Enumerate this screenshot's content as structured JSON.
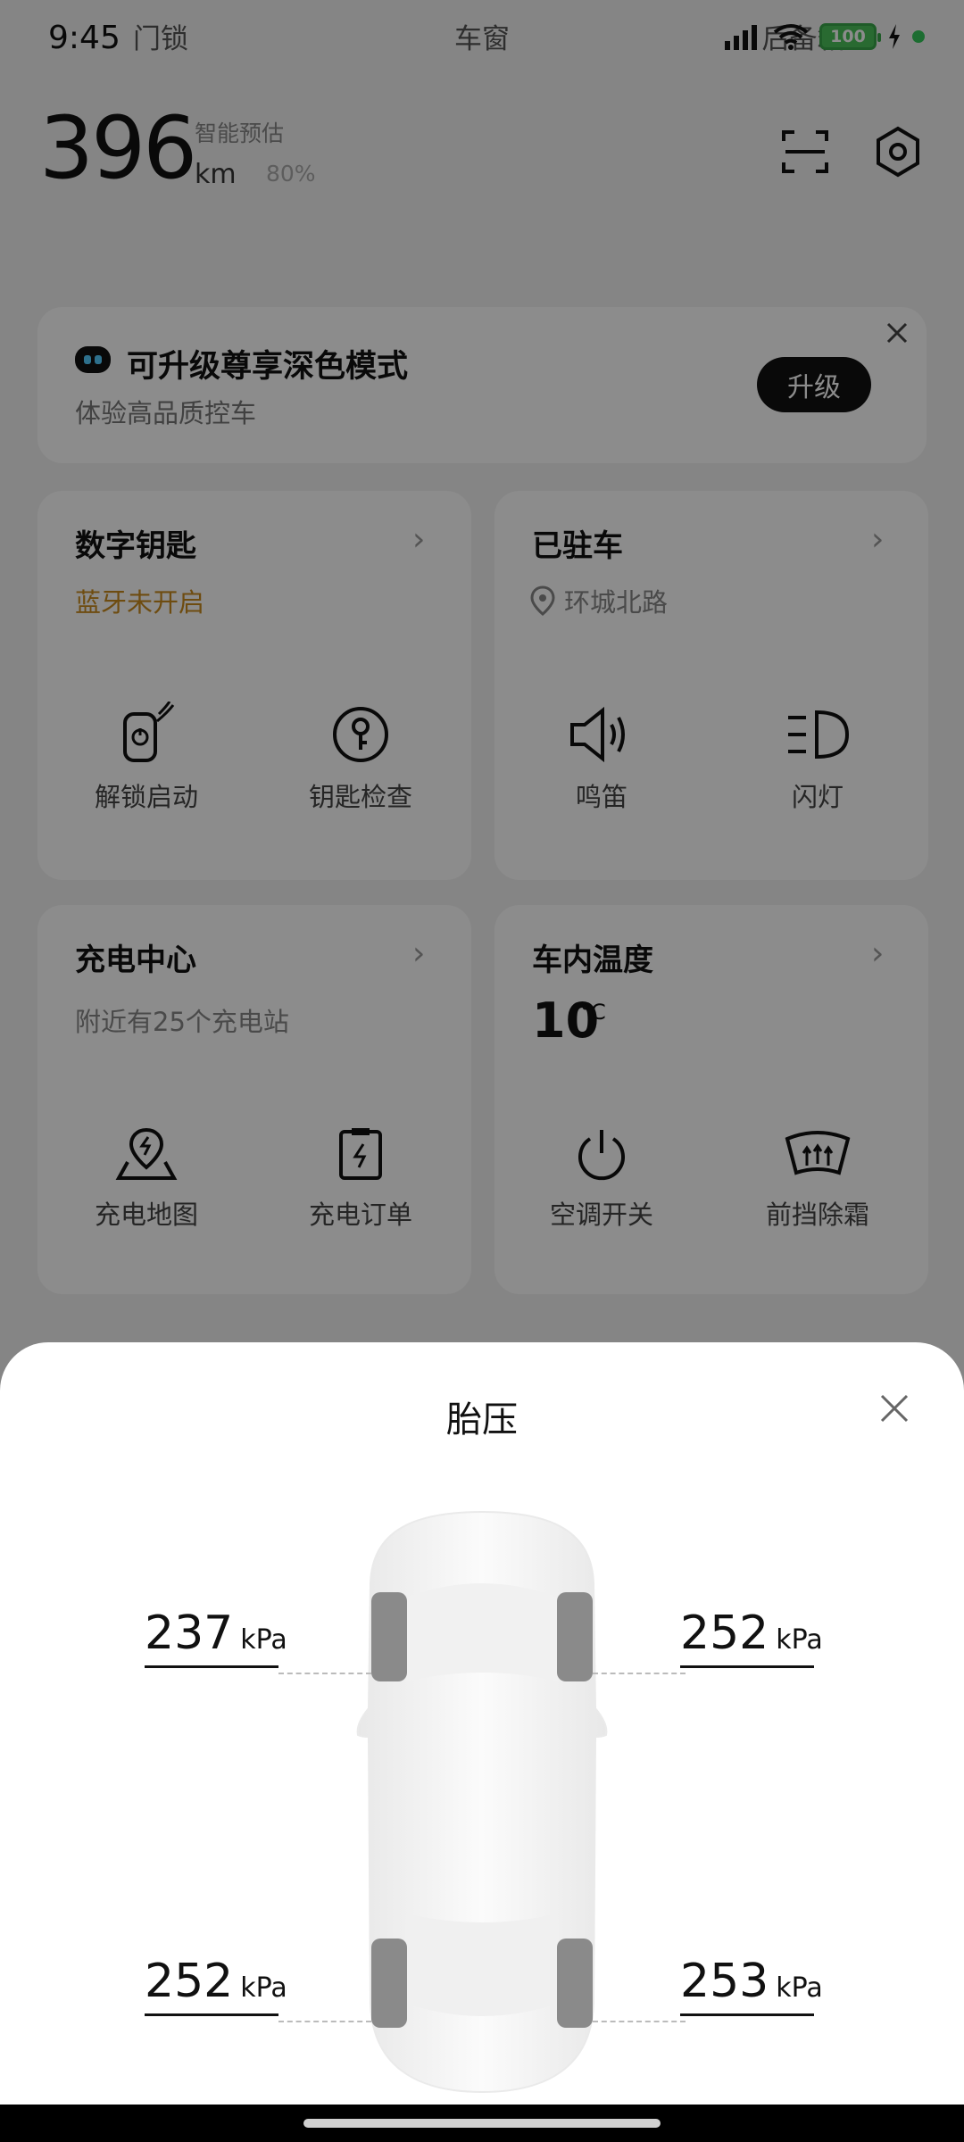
{
  "status_bar": {
    "time": "9:45",
    "battery": "100"
  },
  "header": {
    "range": "396",
    "range_unit": "km",
    "estimate_label": "智能预估",
    "battery_pct": "80%"
  },
  "tabs": [
    {
      "label": "门锁"
    },
    {
      "label": "车窗"
    },
    {
      "label": "后备箱"
    }
  ],
  "promo": {
    "title": "可升级尊享深色模式",
    "subtitle": "体验高品质控车",
    "button": "升级"
  },
  "cards": {
    "digital_key": {
      "title": "数字钥匙",
      "status": "蓝牙未开启",
      "actions": [
        {
          "label": "解锁启动",
          "icon": "phone-unlock-icon"
        },
        {
          "label": "钥匙检查",
          "icon": "key-check-icon"
        }
      ]
    },
    "parked": {
      "title": "已驻车",
      "location": "环城北路",
      "actions": [
        {
          "label": "鸣笛",
          "icon": "horn-icon"
        },
        {
          "label": "闪灯",
          "icon": "headlight-icon"
        }
      ]
    },
    "charging": {
      "title": "充电中心",
      "subtitle": "附近有25个充电站",
      "actions": [
        {
          "label": "充电地图",
          "icon": "charge-map-icon"
        },
        {
          "label": "充电订单",
          "icon": "charge-order-icon"
        }
      ]
    },
    "temperature": {
      "title": "车内温度",
      "value": "10",
      "unit": "°C",
      "actions": [
        {
          "label": "空调开关",
          "icon": "power-icon"
        },
        {
          "label": "前挡除霜",
          "icon": "defrost-icon"
        }
      ]
    }
  },
  "sheet": {
    "title": "胎压",
    "unit": "kPa",
    "tires": {
      "front_left": "237",
      "front_right": "252",
      "rear_left": "252",
      "rear_right": "253"
    }
  },
  "colors": {
    "accent_orange": "#c98a1e",
    "overlay": "rgba(0,0,0,0.45)",
    "battery_green": "#4cc25a"
  }
}
